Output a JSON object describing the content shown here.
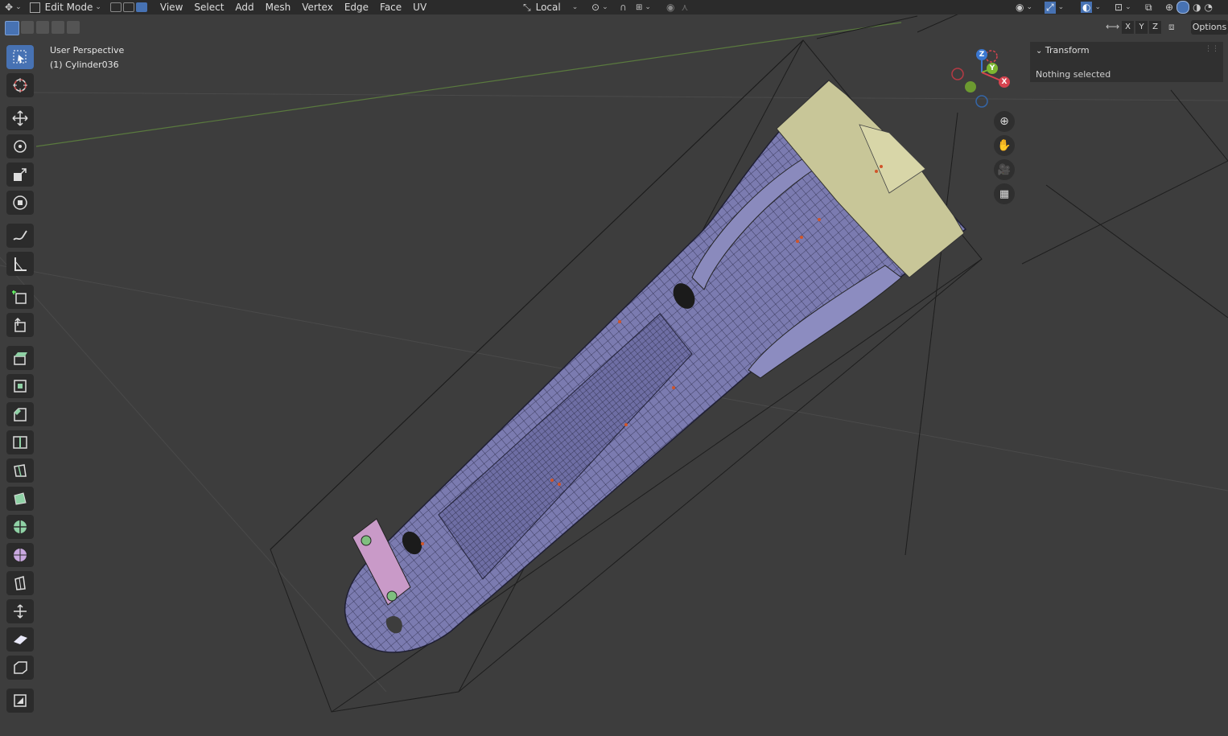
{
  "header": {
    "mode": "Edit Mode",
    "menus": [
      "View",
      "Select",
      "Add",
      "Mesh",
      "Vertex",
      "Edge",
      "Face",
      "UV"
    ],
    "transform_orientation": "Local",
    "options_label": "Options",
    "axis_buttons": [
      "X",
      "Y",
      "Z"
    ]
  },
  "viewport": {
    "perspective": "User Perspective",
    "object": "(1) Cylinder036"
  },
  "gizmo": {
    "z": "Z",
    "y": "Y",
    "x": "X"
  },
  "sidebar": {
    "panel_title": "Transform",
    "message": "Nothing selected"
  },
  "colors": {
    "background": "#3d3d3d",
    "header": "#2b2b2b",
    "accent": "#4772b3",
    "mesh": "#7474a8",
    "cap": "#c9c79a"
  },
  "icons": {
    "toolbar": [
      "select-box-icon",
      "cursor-icon",
      "move-icon",
      "rotate-icon",
      "scale-icon",
      "transform-icon",
      "annotate-icon",
      "measure-icon",
      "add-cube-icon",
      "extrude-region-icon",
      "extrude-manifold-icon",
      "inset-faces-icon",
      "bevel-icon",
      "loop-cut-icon",
      "knife-icon",
      "poly-build-icon",
      "spin-icon",
      "smooth-icon",
      "edge-slide-icon",
      "shrink-fatten-icon",
      "shear-icon",
      "rip-region-icon",
      "add-object-icon"
    ],
    "navigation": [
      "zoom-icon",
      "pan-hand-icon",
      "camera-icon",
      "ortho-grid-icon"
    ]
  }
}
